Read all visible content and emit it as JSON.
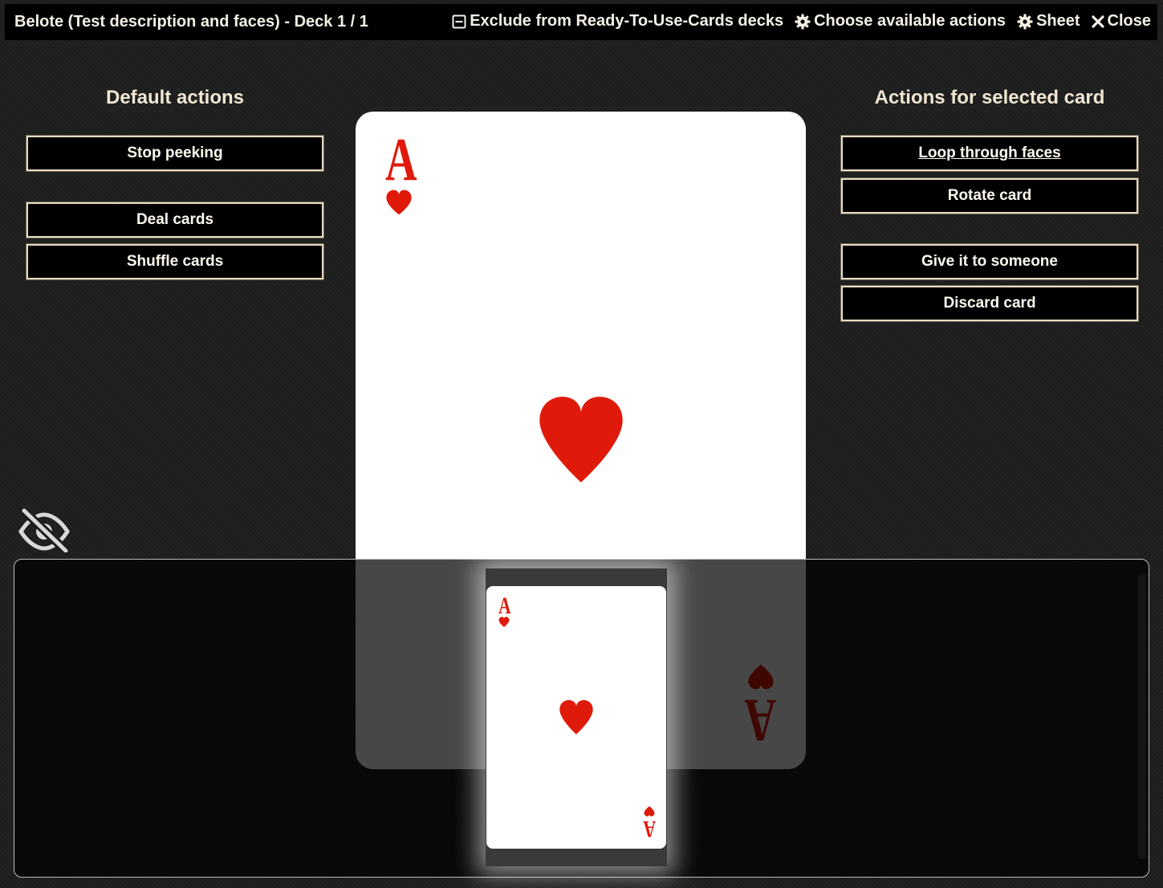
{
  "window": {
    "title": "Belote (Test description and faces) - Deck 1 / 1",
    "header_actions": {
      "exclude_label": "Exclude from Ready-To-Use-Cards decks",
      "choose_label": "Choose available actions",
      "sheet_label": "Sheet",
      "close_label": "Close"
    }
  },
  "left_panel": {
    "title": "Default actions",
    "buttons": {
      "stop_peeking": "Stop peeking",
      "deal_cards": "Deal cards",
      "shuffle_cards": "Shuffle cards"
    }
  },
  "right_panel": {
    "title": "Actions for selected card",
    "buttons": {
      "loop_faces": "Loop through faces",
      "rotate_card": "Rotate card",
      "give_card": "Give it to someone",
      "discard_card": "Discard card"
    }
  },
  "card": {
    "rank": "A",
    "suit": "hearts",
    "suit_symbol": "♥",
    "color": "#e01a0a"
  },
  "icons": {
    "exclude": "minus-square-icon",
    "choose": "gear-icon",
    "sheet": "gear-icon",
    "close": "close-icon",
    "peek_toggle": "eye-slash-icon"
  },
  "colors": {
    "card_red": "#e01a0a",
    "button_border": "#e9dcc2",
    "background": "#1e1e1e"
  }
}
